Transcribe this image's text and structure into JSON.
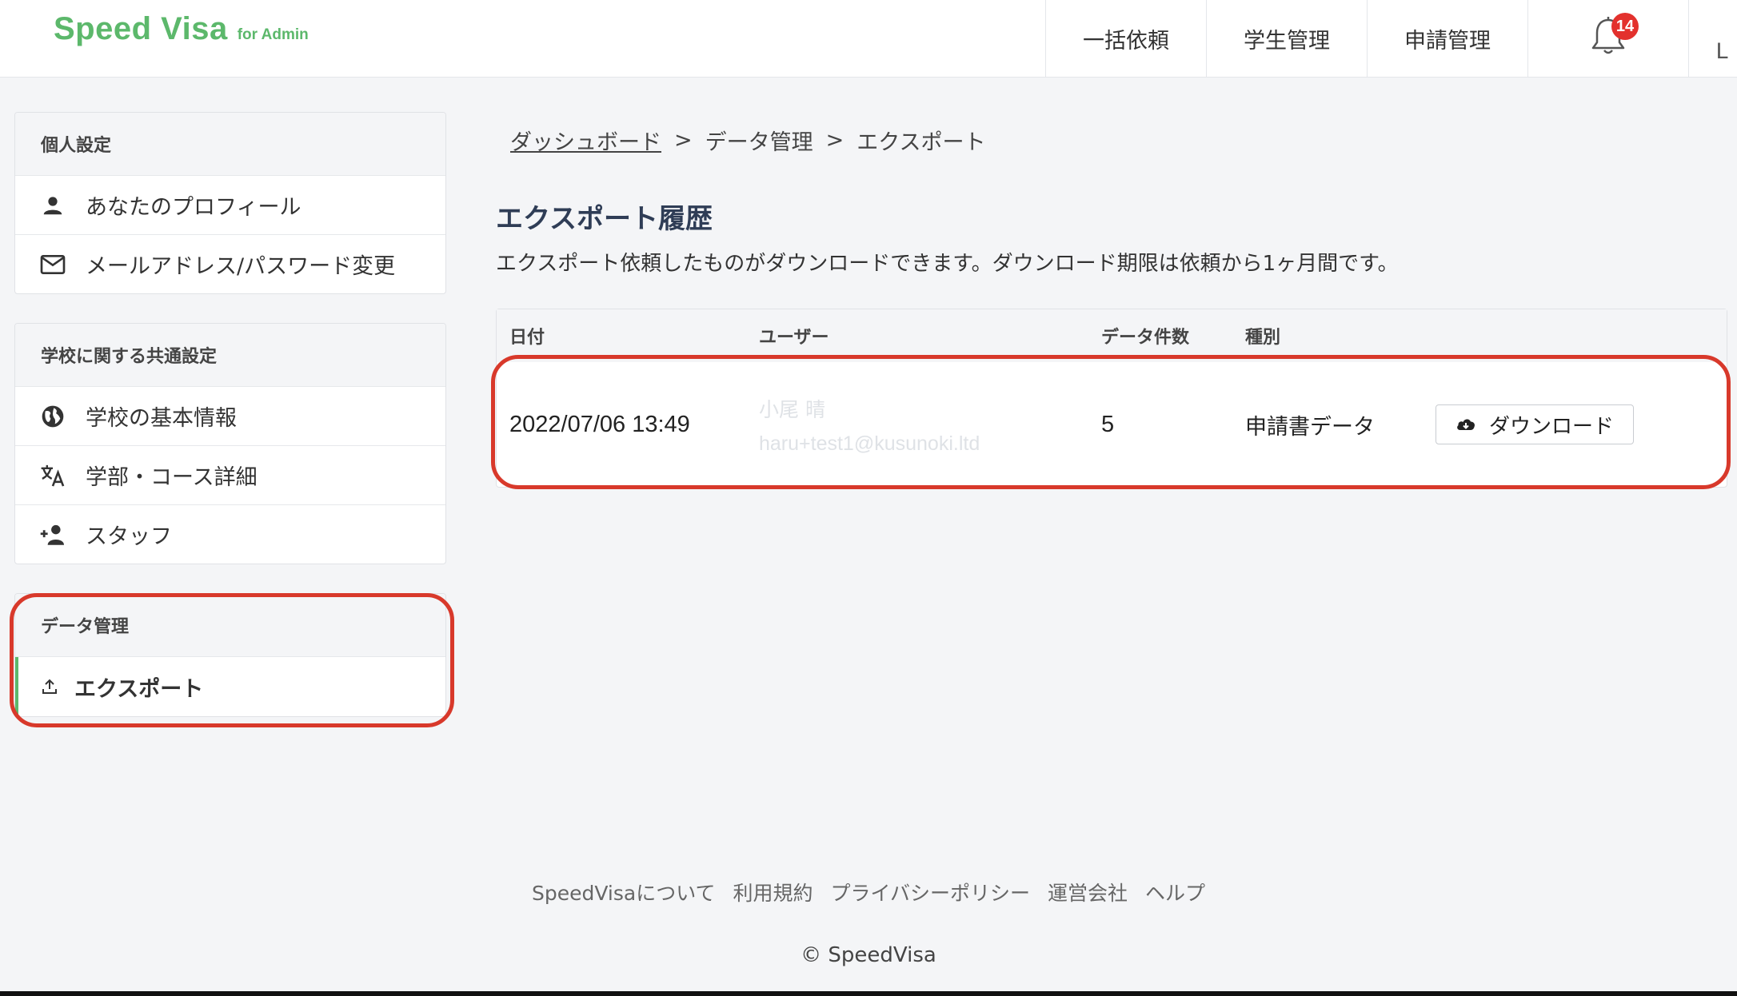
{
  "header": {
    "brand": "Speed Visa",
    "brand_sub": "for Admin",
    "nav": [
      "一括依頼",
      "学生管理",
      "申請管理"
    ],
    "notification_count": "14",
    "cut_label": "L"
  },
  "sidebar": {
    "sections": [
      {
        "heading": "個人設定",
        "items": [
          {
            "label": "あなたのプロフィール",
            "icon": "person-icon"
          },
          {
            "label": "メールアドレス/パスワード変更",
            "icon": "mail-icon"
          }
        ]
      },
      {
        "heading": "学校に関する共通設定",
        "items": [
          {
            "label": "学校の基本情報",
            "icon": "globe-icon"
          },
          {
            "label": "学部・コース詳細",
            "icon": "translate-icon"
          },
          {
            "label": "スタッフ",
            "icon": "add-person-icon"
          }
        ]
      },
      {
        "heading": "データ管理",
        "items": [
          {
            "label": "エクスポート",
            "icon": "upload-icon",
            "active": true
          }
        ]
      }
    ]
  },
  "breadcrumb": [
    "ダッシュボード",
    "データ管理",
    "エクスポート"
  ],
  "breadcrumb_sep": ">",
  "page": {
    "title": "エクスポート履歴",
    "description": "エクスポート依頼したものがダウンロードできます。ダウンロード期限は依頼から1ヶ月間です。"
  },
  "table": {
    "headers": [
      "日付",
      "ユーザー",
      "データ件数",
      "種別"
    ],
    "rows": [
      {
        "date": "2022/07/06 13:49",
        "user_name": "小尾 晴",
        "user_email": "haru+test1@kusunoki.ltd",
        "count": "5",
        "type": "申請書データ",
        "action": "ダウンロード"
      }
    ]
  },
  "footer": {
    "links": [
      "SpeedVisaについて",
      "利用規約",
      "プライバシーポリシー",
      "運営会社",
      "ヘルプ"
    ],
    "copyright": "© SpeedVisa"
  },
  "colors": {
    "brand": "#5cb86b",
    "highlight": "#d8392b",
    "badge": "#e3312d"
  }
}
